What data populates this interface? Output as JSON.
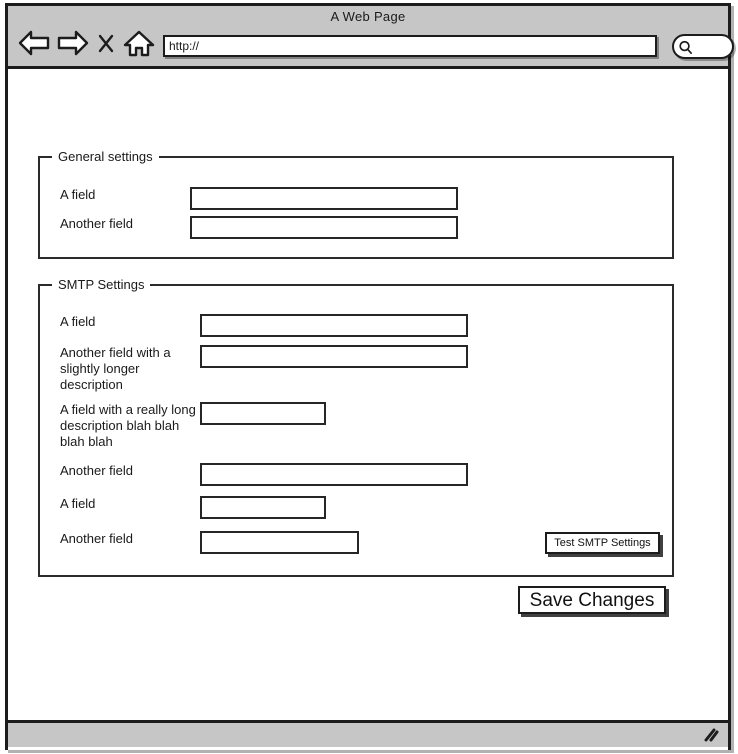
{
  "browser": {
    "title": "A Web Page",
    "url_value": "http://",
    "url_placeholder": "http://",
    "search_value": "",
    "search_placeholder": "",
    "nav": {
      "back_label": "Back",
      "forward_label": "Forward",
      "stop_label": "Stop",
      "home_label": "Home",
      "search_label": "Search"
    },
    "icons": {
      "back": "left-arrow-icon",
      "forward": "right-arrow-icon",
      "stop": "x-icon",
      "home": "home-icon",
      "search": "search-icon",
      "resize": "resize-grip-icon"
    }
  },
  "general_settings": {
    "legend": "General settings",
    "fields": [
      {
        "label": "A field",
        "value": "",
        "placeholder": ""
      },
      {
        "label": "Another field",
        "value": "",
        "placeholder": ""
      }
    ]
  },
  "smtp_settings": {
    "legend": "SMTP Settings",
    "fields": [
      {
        "label": "A field",
        "value": "",
        "placeholder": ""
      },
      {
        "label": "Another field with a\nslightly longer\ndescription",
        "value": "",
        "placeholder": ""
      },
      {
        "label": "A field with a really long\ndescription blah blah\nblah blah",
        "value": "",
        "placeholder": ""
      },
      {
        "label": "Another field",
        "value": "",
        "placeholder": ""
      },
      {
        "label": "A field",
        "value": "",
        "placeholder": ""
      },
      {
        "label": "Another field",
        "value": "",
        "placeholder": ""
      }
    ],
    "test_button_label": "Test SMTP Settings"
  },
  "actions": {
    "save_label": "Save Changes"
  },
  "colors": {
    "chrome": "#c6c6c6",
    "ink": "#1c1c1c",
    "page": "#ffffff"
  }
}
